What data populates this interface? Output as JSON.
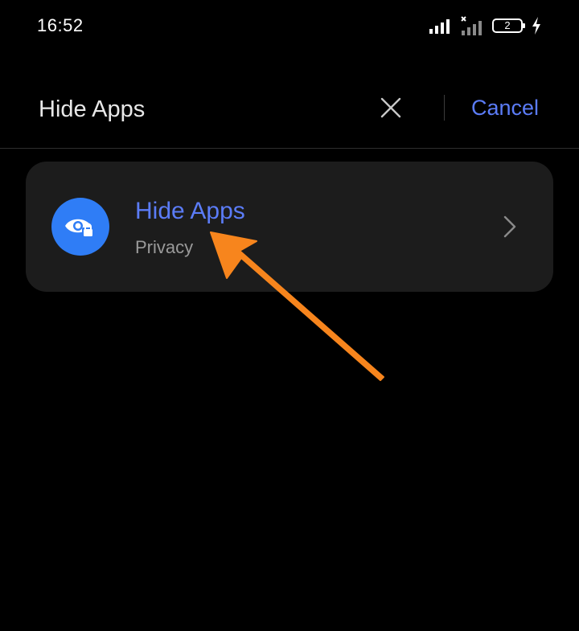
{
  "status_bar": {
    "time": "16:52",
    "battery_level": "2",
    "icons": [
      "signal-icon",
      "no-signal-icon",
      "battery-icon",
      "charging-icon"
    ]
  },
  "search": {
    "query": "Hide Apps",
    "clear_icon": "close-icon",
    "cancel_label": "Cancel"
  },
  "results": [
    {
      "title": "Hide Apps",
      "subtitle": "Privacy",
      "icon": "eye-lock-icon",
      "icon_color": "#2f7df6"
    }
  ],
  "colors": {
    "accent": "#5b7cf7",
    "annotation": "#f7851d",
    "card_background": "#1c1c1c",
    "background": "#000000"
  }
}
